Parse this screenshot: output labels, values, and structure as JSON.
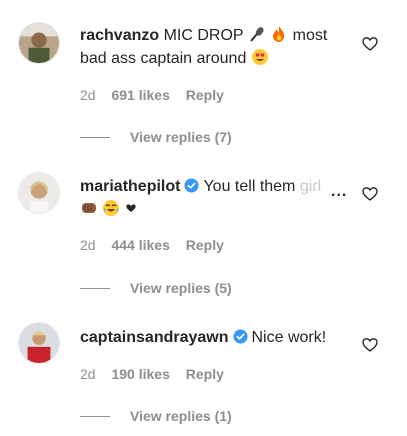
{
  "comments": [
    {
      "username": "rachvanzo",
      "verified": false,
      "text_a": "MIC DROP",
      "text_b": "most",
      "text_c": "bad ass captain around",
      "time": "2d",
      "likes": "691 likes",
      "reply": "Reply",
      "view_replies": "View replies (7)",
      "emojis": [
        "microphone-icon",
        "fire-icon",
        "heart-eyes-icon"
      ]
    },
    {
      "username": "mariathepilot",
      "verified": true,
      "text": "You tell them",
      "text_faded": "girl",
      "more": "...",
      "time": "2d",
      "likes": "444 likes",
      "reply": "Reply",
      "view_replies": "View replies (5)",
      "emojis": [
        "fist-bump-icon",
        "tears-of-joy-icon",
        "black-heart-icon"
      ]
    },
    {
      "username": "captainsandrayawn",
      "verified": true,
      "text": "Nice work!",
      "time": "2d",
      "likes": "190 likes",
      "reply": "Reply",
      "view_replies": "View replies (1)"
    }
  ],
  "colors": {
    "text": "#262626",
    "secondary": "#8e8e8e",
    "verified": "#3897f0"
  }
}
